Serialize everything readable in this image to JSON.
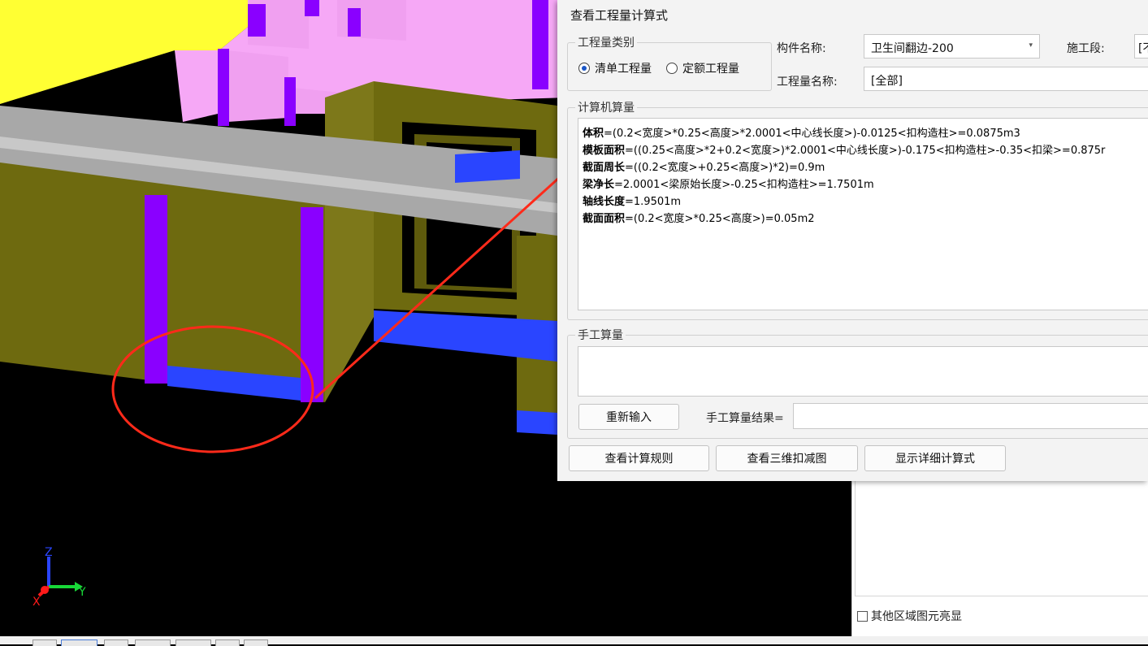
{
  "dialog": {
    "title": "查看工程量计算式",
    "quantity_type": {
      "label": "工程量类别",
      "options": [
        "清单工程量",
        "定额工程量"
      ],
      "selected": "清单工程量"
    },
    "component_name": {
      "label": "构件名称:",
      "value": "卫生间翻边-200"
    },
    "construction_section": {
      "label": "施工段:",
      "value": "[不"
    },
    "quantity_name": {
      "label": "工程量名称:",
      "value": "[全部]"
    },
    "computer_calc": {
      "label": "计算机算量",
      "lines": [
        {
          "key": "体积",
          "expr": "=(0.2<宽度>*0.25<高度>*2.0001<中心线长度>)-0.0125<扣构造柱>=0.0875m3"
        },
        {
          "key": "模板面积",
          "expr": "=((0.25<高度>*2+0.2<宽度>)*2.0001<中心线长度>)-0.175<扣构造柱>-0.35<扣梁>=0.875r"
        },
        {
          "key": "截面周长",
          "expr": "=((0.2<宽度>+0.25<高度>)*2)=0.9m"
        },
        {
          "key": "梁净长",
          "expr": "=2.0001<梁原始长度>-0.25<扣构造柱>=1.7501m"
        },
        {
          "key": "轴线长度",
          "expr": "=1.9501m"
        },
        {
          "key": "截面面积",
          "expr": "=(0.2<宽度>*0.25<高度>)=0.05m2"
        }
      ]
    },
    "manual_calc": {
      "label": "手工算量",
      "reenter_button": "重新输入",
      "result_label": "手工算量结果="
    },
    "buttons": {
      "view_rules": "查看计算规则",
      "view_3d": "查看三维扣减图",
      "show_detail": "显示详细计算式"
    }
  },
  "side_panel": {
    "checkbox_label": "其他区域图元亮显"
  },
  "axes": {
    "z": "Z",
    "y": "Y",
    "x": "X"
  },
  "colors": {
    "annotation_red": "#ff2a1a",
    "wall_olive": "#6e6a0f",
    "column_purple": "#8a00ff",
    "base_blue": "#2a45ff",
    "slab_yellow": "#ffff33",
    "beam_gray": "#a8a8a8",
    "pink": "#f6a8f6"
  }
}
